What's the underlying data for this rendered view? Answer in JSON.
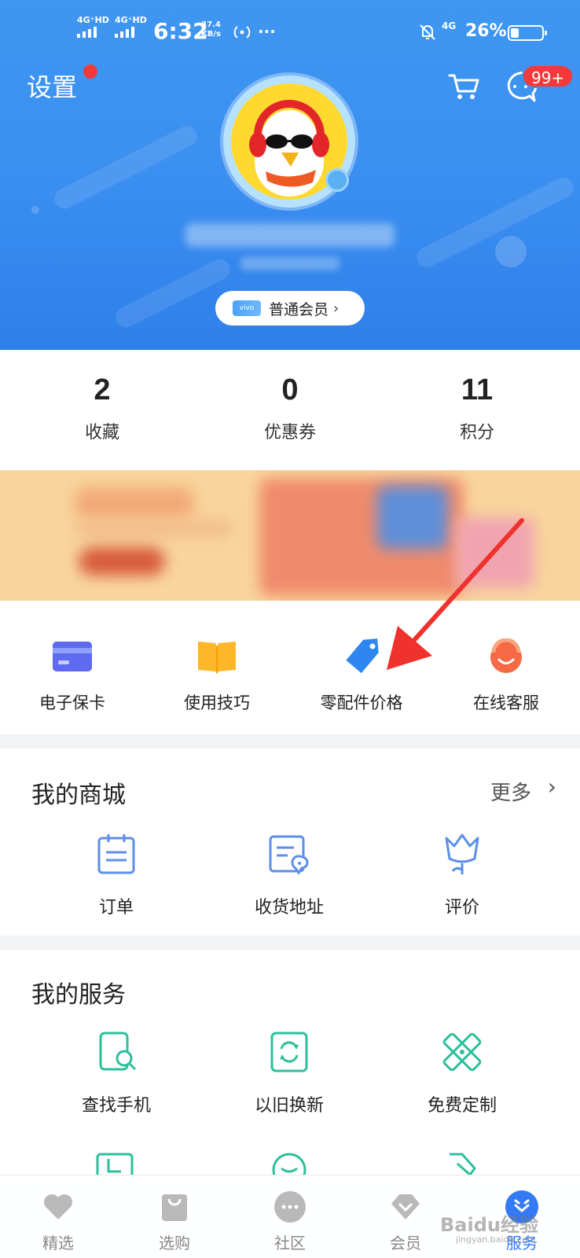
{
  "status_bar": {
    "signal1": "4G⁺HD",
    "signal2": "4G⁺HD",
    "time": "6:32",
    "speed_value": "37.4",
    "speed_unit": "KB/s",
    "more": "···",
    "network": "4G",
    "battery": "26%"
  },
  "header": {
    "settings_label": "设置",
    "message_badge": "99+",
    "member_chip": "vivo",
    "member_label": "普通会员",
    "member_chevron": "›"
  },
  "stats": [
    {
      "value": "2",
      "label": "收藏"
    },
    {
      "value": "0",
      "label": "优惠券"
    },
    {
      "value": "11",
      "label": "积分"
    }
  ],
  "tools": [
    {
      "label": "电子保卡",
      "icon": "card-icon"
    },
    {
      "label": "使用技巧",
      "icon": "book-icon"
    },
    {
      "label": "零配件价格",
      "icon": "price-tag-icon"
    },
    {
      "label": "在线客服",
      "icon": "support-agent-icon"
    }
  ],
  "mall": {
    "title": "我的商城",
    "more": "更多",
    "more_chevron": "›",
    "items": [
      {
        "label": "订单",
        "icon": "order-icon"
      },
      {
        "label": "收货地址",
        "icon": "address-icon"
      },
      {
        "label": "评价",
        "icon": "review-icon"
      }
    ]
  },
  "services": {
    "title": "我的服务",
    "items": [
      {
        "label": "查找手机",
        "icon": "find-phone-icon"
      },
      {
        "label": "以旧换新",
        "icon": "trade-in-icon"
      },
      {
        "label": "免费定制",
        "icon": "customize-icon"
      }
    ]
  },
  "bottom_nav": [
    {
      "label": "精选",
      "icon": "heart-icon",
      "active": false
    },
    {
      "label": "选购",
      "icon": "shopping-bag-icon",
      "active": false
    },
    {
      "label": "社区",
      "icon": "community-icon",
      "active": false
    },
    {
      "label": "会员",
      "icon": "diamond-icon",
      "active": false
    },
    {
      "label": "服务",
      "icon": "service-icon",
      "active": true
    }
  ],
  "watermark": {
    "text": "Baidu经验",
    "sub": "jingyan.baidu.com"
  },
  "colors": {
    "header_blue": "#3a8ef0",
    "accent_blue": "#3479f5",
    "badge_red": "#f23a3a",
    "service_green": "#2cbf9c",
    "mall_blue": "#5b8fe8"
  }
}
